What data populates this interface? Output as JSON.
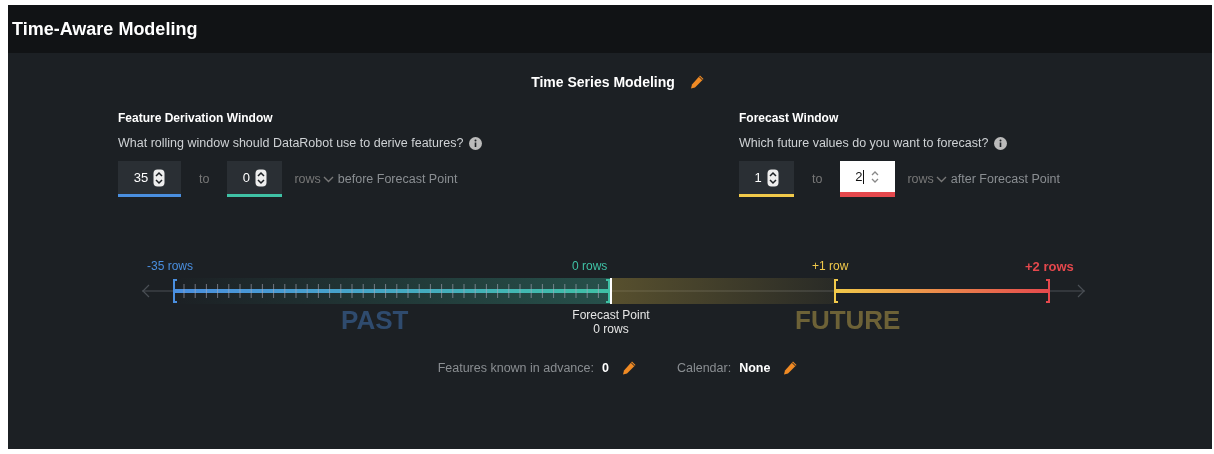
{
  "window": {
    "title": "Time-Aware Modeling"
  },
  "section_title": "Time Series Modeling",
  "windows": [
    {
      "heading": "Feature Derivation Window",
      "question": "What rolling window should DataRobot use to derive features?",
      "from": {
        "value": "35",
        "color": "#4a8fe0",
        "focused": false
      },
      "joiner": "to",
      "to": {
        "value": "0",
        "color": "#3fc1a5",
        "focused": false
      },
      "unit": "rows",
      "suffix": "before Forecast Point"
    },
    {
      "heading": "Forecast Window",
      "question": "Which future values do you want to forecast?",
      "from": {
        "value": "1",
        "color": "#f1c94a",
        "focused": false
      },
      "joiner": "to",
      "to": {
        "value": "2",
        "color": "#e5484d",
        "focused": true
      },
      "unit": "rows",
      "suffix": "after Forecast Point"
    }
  ],
  "timeline": {
    "start_label": "-35 rows",
    "now_label": "0 rows",
    "future_start_label": "+1 row",
    "end_label": "+2 rows",
    "past_label": "PAST",
    "future_label": "FUTURE",
    "forecast_point_lines": [
      "Forecast Point",
      "0 rows"
    ]
  },
  "footer": [
    {
      "label": "Features known in advance:",
      "value": "0"
    },
    {
      "label": "Calendar:",
      "value": "None"
    }
  ]
}
